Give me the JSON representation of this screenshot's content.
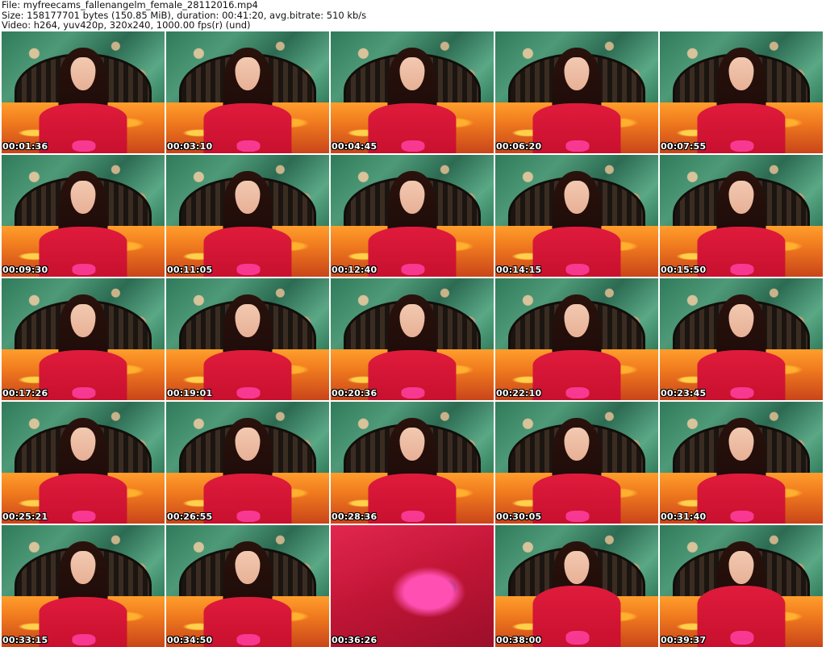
{
  "header": {
    "line1": "File: myfreecams_fallenangelm_female_28112016.mp4",
    "line2": "Size: 158177701 bytes (150.85 MiB), duration: 00:41:20, avg.bitrate: 510 kb/s",
    "line3": "Video: h264, yuv420p, 320x240, 1000.00 fps(r) (und)"
  },
  "thumbnails": [
    "00:01:36",
    "00:03:10",
    "00:04:45",
    "00:06:20",
    "00:07:55",
    "00:09:30",
    "00:11:05",
    "00:12:40",
    "00:14:15",
    "00:15:50",
    "00:17:26",
    "00:19:01",
    "00:20:36",
    "00:22:10",
    "00:23:45",
    "00:25:21",
    "00:26:55",
    "00:28:36",
    "00:30:05",
    "00:31:40",
    "00:33:15",
    "00:34:50",
    "00:36:26",
    "00:38:00",
    "00:39:37"
  ]
}
